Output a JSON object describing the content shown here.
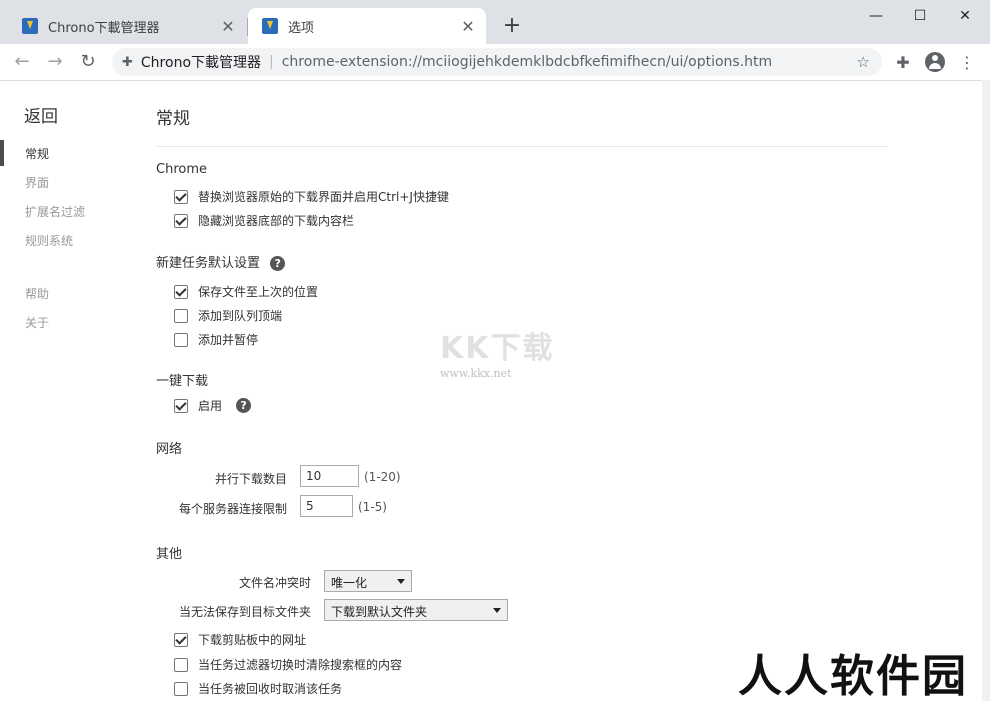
{
  "window": {
    "tabs": [
      {
        "title": "Chrono下載管理器"
      },
      {
        "title": "选项"
      }
    ],
    "close_glyph": "✕",
    "new_tab_glyph": "+",
    "controls": {
      "minimize": "—",
      "maximize": "☐",
      "close": "✕"
    }
  },
  "toolbar": {
    "back_glyph": "←",
    "forward_glyph": "→",
    "reload_glyph": "↻",
    "site_name": "Chrono下載管理器",
    "url": "chrome-extension://mciiogijehkdemklbdcbfkefimifhecn/ui/options.htm",
    "star_glyph": "☆",
    "extensions_glyph": "✚",
    "menu_glyph": "⋮"
  },
  "sidebar": {
    "back_label": "返回",
    "items": [
      {
        "label": "常规",
        "active": true
      },
      {
        "label": "界面"
      },
      {
        "label": "扩展名过滤"
      },
      {
        "label": "规则系统"
      },
      {
        "label": "帮助"
      },
      {
        "label": "关于"
      }
    ]
  },
  "main": {
    "page_title": "常规",
    "help_glyph": "?",
    "chrome": {
      "title": "Chrome",
      "options": [
        {
          "label": "替换浏览器原始的下载界面并启用Ctrl+J快捷键",
          "checked": true
        },
        {
          "label": "隐藏浏览器底部的下载内容栏",
          "checked": true
        }
      ]
    },
    "new_task": {
      "title": "新建任务默认设置",
      "options": [
        {
          "label": "保存文件至上次的位置",
          "checked": true
        },
        {
          "label": "添加到队列顶端",
          "checked": false
        },
        {
          "label": "添加并暂停",
          "checked": false
        }
      ]
    },
    "one_click": {
      "title": "一键下载",
      "options": [
        {
          "label": "启用",
          "checked": true
        }
      ]
    },
    "network": {
      "title": "网络",
      "parallel_label": "并行下载数目",
      "parallel_value": "10",
      "parallel_range": "(1-20)",
      "per_server_label": "每个服务器连接限制",
      "per_server_value": "5",
      "per_server_range": "(1-5)"
    },
    "other": {
      "title": "其他",
      "conflict_label": "文件名冲突时",
      "conflict_value": "唯一化",
      "cannot_save_label": "当无法保存到目标文件夹",
      "cannot_save_value": "下载到默认文件夹",
      "options": [
        {
          "label": "下载剪贴板中的网址",
          "checked": true
        },
        {
          "label": "当任务过滤器切换时清除搜索框的内容",
          "checked": false
        },
        {
          "label": "当任务被回收时取消该任务",
          "checked": false
        }
      ]
    }
  },
  "watermark": {
    "logo": "KK下载",
    "url": "www.kkx.net",
    "corner": "人人软件园"
  }
}
